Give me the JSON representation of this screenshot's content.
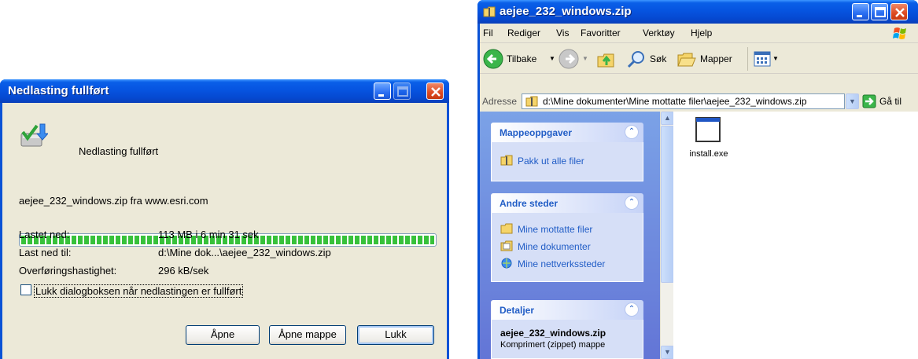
{
  "download_dialog": {
    "title": "Nedlasting fullført",
    "status_heading": "Nedlasting fullført",
    "source_line": "aejee_232_windows.zip fra www.esri.com",
    "progress": 1.0,
    "rows": [
      {
        "label": "Lastet ned:",
        "value": "113 MB i 6 min 31 sek"
      },
      {
        "label": "Last ned til:",
        "value": "d:\\Mine dok...\\aejee_232_windows.zip"
      },
      {
        "label": "Overføringshastighet:",
        "value": "296 kB/sek"
      }
    ],
    "close_when_done_label": "Lukk dialogboksen når nedlastingen er fullført",
    "close_when_done_checked": false,
    "buttons": {
      "open": "Åpne",
      "open_folder": "Åpne mappe",
      "close": "Lukk"
    }
  },
  "explorer": {
    "title": "aejee_232_windows.zip",
    "menu": [
      "Fil",
      "Rediger",
      "Vis",
      "Favoritter",
      "Verktøy",
      "Hjelp"
    ],
    "toolbar": {
      "back": "Tilbake",
      "search": "Søk",
      "folders": "Mapper"
    },
    "address_label": "Adresse",
    "address_value": "d:\\Mine dokumenter\\Mine mottatte filer\\aejee_232_windows.zip",
    "go_label": "Gå til",
    "panes": [
      {
        "title": "Mappeoppgaver",
        "links": [
          "Pakk ut alle filer"
        ]
      },
      {
        "title": "Andre steder",
        "links": [
          "Mine mottatte filer",
          "Mine dokumenter",
          "Mine nettverkssteder"
        ]
      },
      {
        "title": "Detaljer",
        "details_name": "aejee_232_windows.zip",
        "details_type": "Komprimert (zippet) mappe"
      }
    ],
    "files": [
      {
        "name": "install.exe",
        "icon": "exe-window-icon"
      }
    ]
  },
  "colors": {
    "xp_blue": "#0a52d6",
    "pane_link": "#215dc6",
    "progress_green": "#37c13a",
    "dialog_bg": "#ece9d8"
  }
}
